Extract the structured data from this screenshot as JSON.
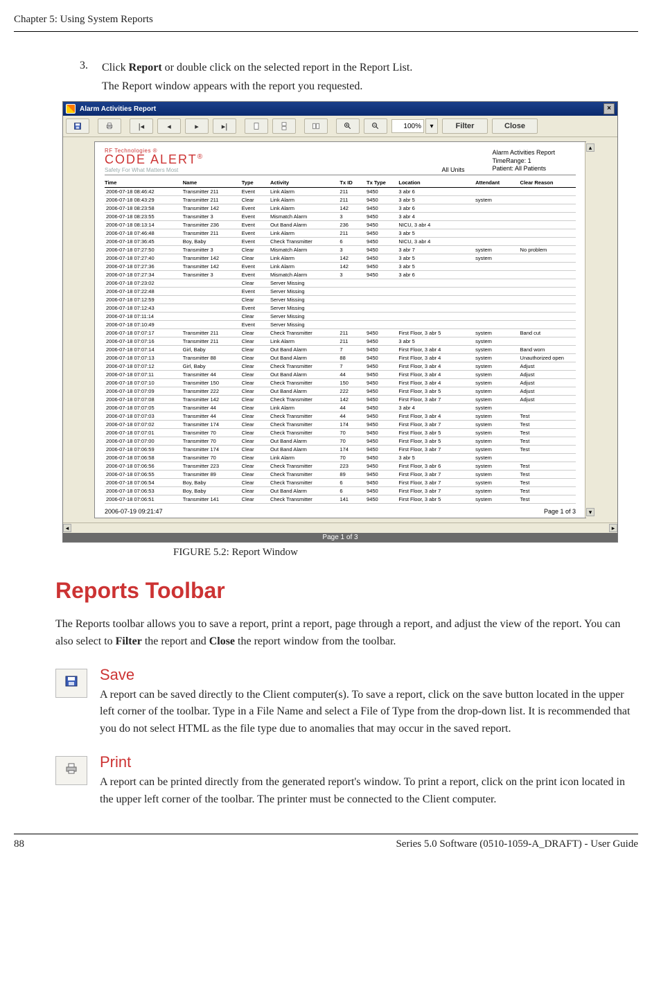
{
  "page": {
    "running_head": "Chapter 5: Using System Reports",
    "step_num": "3.",
    "step_text_pre": "Click ",
    "step_text_bold": "Report",
    "step_text_post": " or double click on the selected report in the Report List.",
    "step_sub": "The Report window appears with the report you requested.",
    "fig_caption": "FIGURE 5.2:    Report Window",
    "section_title": "Reports Toolbar",
    "lead_pre": "The Reports toolbar allows you to save a report, print a report, page through a report, and adjust the view of the report. You can also select to ",
    "lead_b1": "Filter",
    "lead_mid": " the report and ",
    "lead_b2": "Close",
    "lead_post": " the report window from the toolbar.",
    "save_title": "Save",
    "save_body": "A report can be saved directly to the Client computer(s). To save a report, click on the save button located in the upper left corner of the toolbar. Type in a File Name and select a File of Type from the drop-down list. It is recommended that you do not select HTML as the file type due to anomalies that may occur in the saved report.",
    "print_title": "Print",
    "print_body": "A report can be printed directly from the generated report's window. To print a report, click on the print icon located in the upper left corner of the toolbar. The printer must be connected to the Client computer.",
    "footer_page": "88",
    "footer_doc": "Series 5.0 Software (0510-1059-A_DRAFT) - User Guide"
  },
  "report_window": {
    "title": "Alarm Activities Report",
    "toolbar": {
      "zoom": "100%",
      "filter": "Filter",
      "close": "Close"
    },
    "brand_top": "RF Technologies ®",
    "brand_name": "CODE ALERT",
    "brand_tag": "Safety For What Matters Most",
    "all_units": "All Units",
    "hdr_title": "Alarm Activities Report",
    "hdr_time": "TimeRange: 1",
    "hdr_patients": "Patient: All Patients",
    "columns": [
      "Time",
      "Name",
      "Type",
      "Activity",
      "Tx ID",
      "Tx Type",
      "Location",
      "Attendant",
      "Clear Reason"
    ],
    "rows": [
      [
        "2006-07-18 08:46:42",
        "Transmitter 211",
        "Event",
        "Link Alarm",
        "211",
        "9450",
        "3 abr 6",
        "",
        ""
      ],
      [
        "2006-07-18 08:43:29",
        "Transmitter 211",
        "Clear",
        "Link Alarm",
        "211",
        "9450",
        "3 abr 5",
        "system",
        ""
      ],
      [
        "2006-07-18 08:23:58",
        "Transmitter 142",
        "Event",
        "Link Alarm",
        "142",
        "9450",
        "3 abr 6",
        "",
        ""
      ],
      [
        "2006-07-18 08:23:55",
        "Transmitter 3",
        "Event",
        "Mismatch Alarm",
        "3",
        "9450",
        "3 abr 4",
        "",
        ""
      ],
      [
        "2006-07-18 08:13:14",
        "Transmitter 236",
        "Event",
        "Out Band Alarm",
        "236",
        "9450",
        "NICU, 3 abr 4",
        "",
        ""
      ],
      [
        "2006-07-18 07:46:48",
        "Transmitter 211",
        "Event",
        "Link Alarm",
        "211",
        "9450",
        "3 abr 5",
        "",
        ""
      ],
      [
        "2006-07-18 07:36:45",
        "Boy, Baby",
        "Event",
        "Check Transmitter",
        "6",
        "9450",
        "NICU, 3 abr 4",
        "",
        ""
      ],
      [
        "2006-07-18 07:27:50",
        "Transmitter 3",
        "Clear",
        "Mismatch Alarm",
        "3",
        "9450",
        "3 abr 7",
        "system",
        "No problem"
      ],
      [
        "2006-07-18 07:27:40",
        "Transmitter 142",
        "Clear",
        "Link Alarm",
        "142",
        "9450",
        "3 abr 5",
        "system",
        ""
      ],
      [
        "2006-07-18 07:27:36",
        "Transmitter 142",
        "Event",
        "Link Alarm",
        "142",
        "9450",
        "3 abr 5",
        "",
        ""
      ],
      [
        "2006-07-18 07:27:34",
        "Transmitter 3",
        "Event",
        "Mismatch Alarm",
        "3",
        "9450",
        "3 abr 6",
        "",
        ""
      ],
      [
        "2006-07-18 07:23:02",
        "",
        "Clear",
        "Server Missing",
        "",
        "",
        "",
        "",
        ""
      ],
      [
        "2006-07-18 07:22:48",
        "",
        "Event",
        "Server Missing",
        "",
        "",
        "",
        "",
        ""
      ],
      [
        "2006-07-18 07:12:59",
        "",
        "Clear",
        "Server Missing",
        "",
        "",
        "",
        "",
        ""
      ],
      [
        "2006-07-18 07:12:43",
        "",
        "Event",
        "Server Missing",
        "",
        "",
        "",
        "",
        ""
      ],
      [
        "2006-07-18 07:11:14",
        "",
        "Clear",
        "Server Missing",
        "",
        "",
        "",
        "",
        ""
      ],
      [
        "2006-07-18 07:10:49",
        "",
        "Event",
        "Server Missing",
        "",
        "",
        "",
        "",
        ""
      ],
      [
        "2006-07-18 07:07:17",
        "Transmitter 211",
        "Clear",
        "Check Transmitter",
        "211",
        "9450",
        "First Floor, 3 abr 5",
        "system",
        "Band cut"
      ],
      [
        "2006-07-18 07:07:16",
        "Transmitter 211",
        "Clear",
        "Link Alarm",
        "211",
        "9450",
        "3 abr 5",
        "system",
        ""
      ],
      [
        "2006-07-18 07:07:14",
        "Girl, Baby",
        "Clear",
        "Out Band Alarm",
        "7",
        "9450",
        "First Floor, 3 abr 4",
        "system",
        "Band worn"
      ],
      [
        "2006-07-18 07:07:13",
        "Transmitter 88",
        "Clear",
        "Out Band Alarm",
        "88",
        "9450",
        "First Floor, 3 abr 4",
        "system",
        "Unauthorized open"
      ],
      [
        "2006-07-18 07:07:12",
        "Girl, Baby",
        "Clear",
        "Check Transmitter",
        "7",
        "9450",
        "First Floor, 3 abr 4",
        "system",
        "Adjust"
      ],
      [
        "2006-07-18 07:07:11",
        "Transmitter 44",
        "Clear",
        "Out Band Alarm",
        "44",
        "9450",
        "First Floor, 3 abr 4",
        "system",
        "Adjust"
      ],
      [
        "2006-07-18 07:07:10",
        "Transmitter 150",
        "Clear",
        "Check Transmitter",
        "150",
        "9450",
        "First Floor, 3 abr 4",
        "system",
        "Adjust"
      ],
      [
        "2006-07-18 07:07:09",
        "Transmitter 222",
        "Clear",
        "Out Band Alarm",
        "222",
        "9450",
        "First Floor, 3 abr 5",
        "system",
        "Adjust"
      ],
      [
        "2006-07-18 07:07:08",
        "Transmitter 142",
        "Clear",
        "Check Transmitter",
        "142",
        "9450",
        "First Floor, 3 abr 7",
        "system",
        "Adjust"
      ],
      [
        "2006-07-18 07:07:05",
        "Transmitter 44",
        "Clear",
        "Link Alarm",
        "44",
        "9450",
        "3 abr 4",
        "system",
        ""
      ],
      [
        "2006-07-18 07:07:03",
        "Transmitter 44",
        "Clear",
        "Check Transmitter",
        "44",
        "9450",
        "First Floor, 3 abr 4",
        "system",
        "Test"
      ],
      [
        "2006-07-18 07:07:02",
        "Transmitter 174",
        "Clear",
        "Check Transmitter",
        "174",
        "9450",
        "First Floor, 3 abr 7",
        "system",
        "Test"
      ],
      [
        "2006-07-18 07:07:01",
        "Transmitter 70",
        "Clear",
        "Check Transmitter",
        "70",
        "9450",
        "First Floor, 3 abr 5",
        "system",
        "Test"
      ],
      [
        "2006-07-18 07:07:00",
        "Transmitter 70",
        "Clear",
        "Out Band Alarm",
        "70",
        "9450",
        "First Floor, 3 abr 5",
        "system",
        "Test"
      ],
      [
        "2006-07-18 07:06:59",
        "Transmitter 174",
        "Clear",
        "Out Band Alarm",
        "174",
        "9450",
        "First Floor, 3 abr 7",
        "system",
        "Test"
      ],
      [
        "2006-07-18 07:06:58",
        "Transmitter 70",
        "Clear",
        "Link Alarm",
        "70",
        "9450",
        "3 abr 5",
        "system",
        ""
      ],
      [
        "2006-07-18 07:06:56",
        "Transmitter 223",
        "Clear",
        "Check Transmitter",
        "223",
        "9450",
        "First Floor, 3 abr 6",
        "system",
        "Test"
      ],
      [
        "2006-07-18 07:06:55",
        "Transmitter 89",
        "Clear",
        "Check Transmitter",
        "89",
        "9450",
        "First Floor, 3 abr 7",
        "system",
        "Test"
      ],
      [
        "2006-07-18 07:06:54",
        "Boy, Baby",
        "Clear",
        "Check Transmitter",
        "6",
        "9450",
        "First Floor, 3 abr 7",
        "system",
        "Test"
      ],
      [
        "2006-07-18 07:06:53",
        "Boy, Baby",
        "Clear",
        "Out Band Alarm",
        "6",
        "9450",
        "First Floor, 3 abr 7",
        "system",
        "Test"
      ],
      [
        "2006-07-18 07:06:51",
        "Transmitter 141",
        "Clear",
        "Check Transmitter",
        "141",
        "9450",
        "First Floor, 3 abr 5",
        "system",
        "Test"
      ]
    ],
    "timestamp": "2006-07-19 09:21:47",
    "pager": "Page 1 of 3",
    "bottom_bar": "Page 1 of 3"
  }
}
